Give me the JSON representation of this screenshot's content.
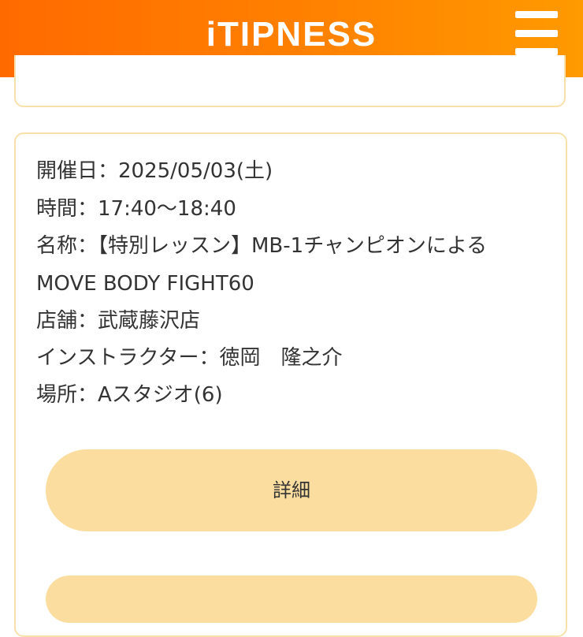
{
  "header": {
    "brand": "iTIPNESS",
    "menu_icon": "hamburger-menu-icon",
    "background_color": "#ff7a00"
  },
  "lesson": {
    "date_line": "開催日：2025/05/03(土)",
    "time_line": "時間：17:40〜18:40",
    "name_line_1": "名称：【特別レッスン】MB-1チャンピオンによる",
    "name_line_2": "MOVE BODY FIGHT60",
    "store_line": "店舗：武蔵藤沢店",
    "instructor_line": "インストラクター：徳岡　隆之介",
    "place_line": "場所：Aスタジオ(6)",
    "detail_label": "詳細"
  },
  "colors": {
    "card_border": "#f8e0ab",
    "button_fill": "#fbde9f",
    "text": "#333333"
  }
}
